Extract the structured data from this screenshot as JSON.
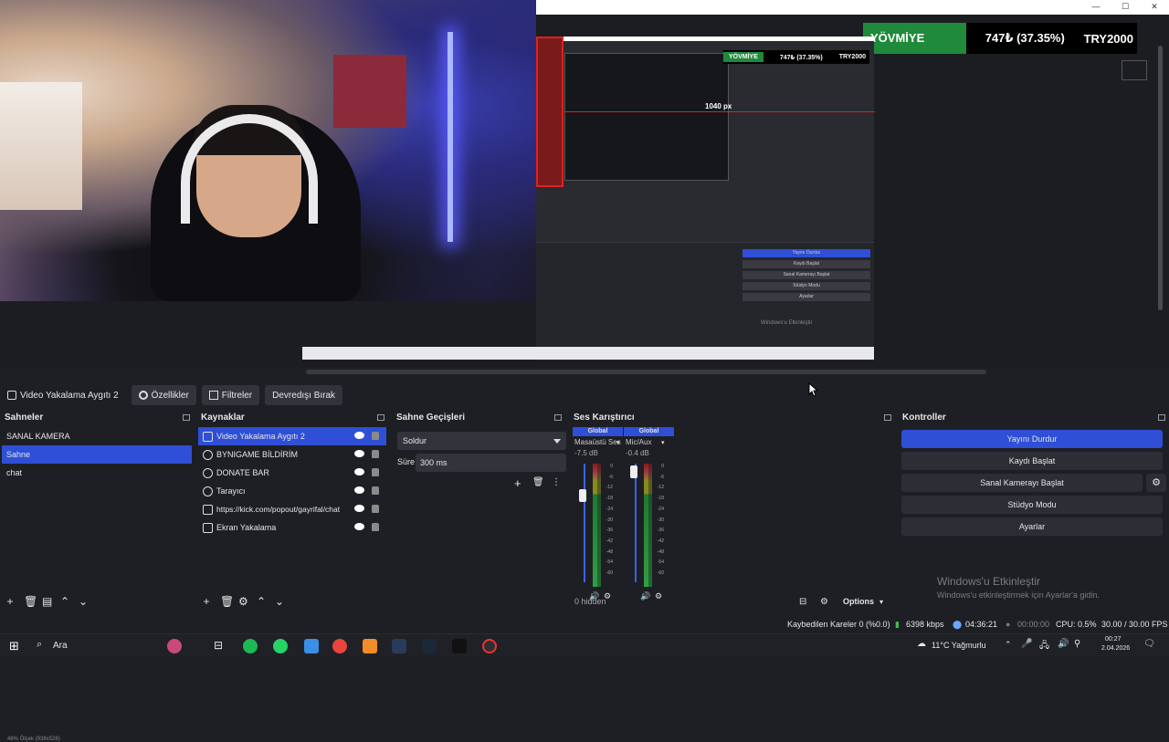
{
  "window_controls": {
    "minimize": "—",
    "maximize": "☐",
    "close": "✕"
  },
  "preview": {
    "gain_banner": {
      "label": "YÖVMİYE",
      "percent": "747₺ (37.35%)",
      "amount": "TRY2000"
    },
    "nested_banner": {
      "label": "YÖVMİYE",
      "percent": "747₺ (37.35%)",
      "amount": "TRY2000"
    },
    "measure_label": "1040 px",
    "nested_buttons": [
      "Yayını Durdur",
      "Kaydı Başlat",
      "Sanal Kamerayı Başlat",
      "Stüdyo Modu",
      "Ayarlar"
    ],
    "nested_watermark": "Windows'u Etkinleştir",
    "zoom_label": "48%   Ölçek (938x528)"
  },
  "source_toolbar": {
    "current_source": "Video Yakalama Aygıtı 2",
    "properties": "Özellikler",
    "filters": "Filtreler",
    "deactivate": "Devredışı Bırak"
  },
  "scenes": {
    "title": "Sahneler",
    "items": [
      "SANAL KAMERA",
      "Sahne",
      "chat"
    ],
    "selected_index": 1
  },
  "sources": {
    "title": "Kaynaklar",
    "items": [
      {
        "label": "Video Yakalama Aygıtı 2",
        "icon": "camera-icon"
      },
      {
        "label": "BYNIGAME BİLDİRİM",
        "icon": "globe-icon"
      },
      {
        "label": "DONATE BAR",
        "icon": "globe-icon"
      },
      {
        "label": "Tarayıcı",
        "icon": "globe-icon"
      },
      {
        "label": "https://kick.com/popout/gayrifal/chat",
        "icon": "window-icon"
      },
      {
        "label": "Ekran Yakalama",
        "icon": "monitor-icon"
      }
    ],
    "selected_index": 0
  },
  "transitions": {
    "title": "Sahne Geçişleri",
    "selected": "Soldur",
    "duration_label": "Süre",
    "duration_value": "300 ms"
  },
  "mixer": {
    "title": "Ses Karıştırıcı",
    "channels": [
      {
        "tag": "Global",
        "name": "Masaüstü Ses",
        "db": "-7.5 dB",
        "level": 0.25
      },
      {
        "tag": "Global",
        "name": "Mic/Aux",
        "db": "-0.4 dB",
        "level": 0.02
      }
    ],
    "scale": [
      "0",
      "-6",
      "-12",
      "-18",
      "-24",
      "-30",
      "-36",
      "-42",
      "-48",
      "-54",
      "-60"
    ],
    "hidden": "0 hidden",
    "options": "Options"
  },
  "controls": {
    "title": "Kontroller",
    "stop_stream": "Yayını Durdur",
    "start_recording": "Kaydı Başlat",
    "start_virtual_cam": "Sanal Kamerayı Başlat",
    "studio_mode": "Stüdyo Modu",
    "settings": "Ayarlar"
  },
  "watermark": {
    "title": "Windows'u Etkinleştir",
    "subtitle": "Windows'u etkinleştirmek için Ayarlar'a gidin."
  },
  "status": {
    "dropped_frames": "Kaybedilen Kareler 0 (%0.0)",
    "bitrate": "6398 kbps",
    "stream_time": "04:36:21",
    "record_time": "00:00:00",
    "cpu": "CPU: 0.5%",
    "fps": "30.00 / 30.00 FPS"
  },
  "taskbar": {
    "search": "Ara",
    "weather": "11°C  Yağmurlu",
    "time": "00:27",
    "date": "2.04.2026"
  },
  "colors": {
    "accent": "#2e4fd6",
    "banner_green": "#1f8a3c",
    "measure_red": "#e02020"
  }
}
